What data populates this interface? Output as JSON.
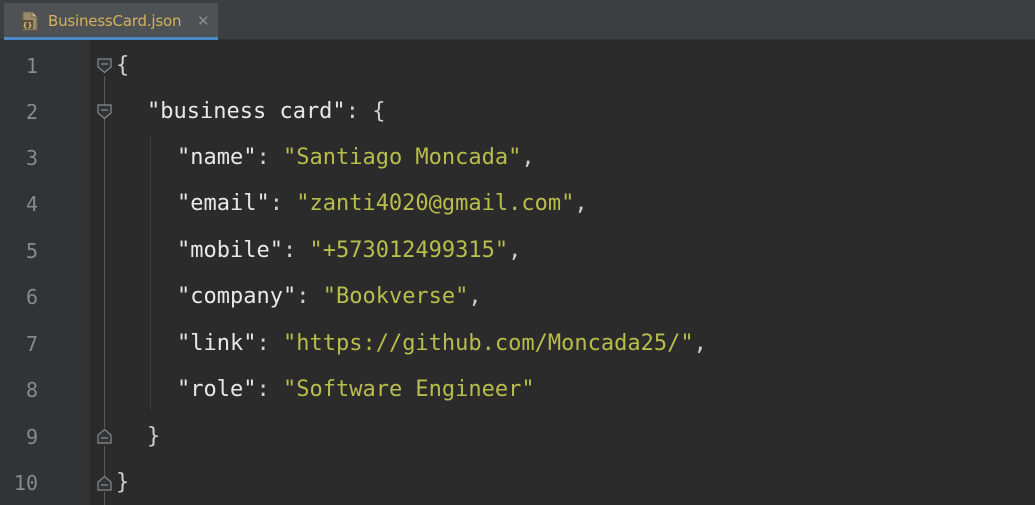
{
  "tab": {
    "file_name": "BusinessCard.json",
    "close_glyph": "✕",
    "icon": "json-file-icon"
  },
  "colors": {
    "background": "#2b2b2b",
    "gutter": "#313335",
    "tab_label": "#d4b25b",
    "string": "#b9bd4b",
    "key": "#e8e8e8",
    "line_number": "#8a8a8a"
  },
  "line_numbers": [
    "1",
    "2",
    "3",
    "4",
    "5",
    "6",
    "7",
    "8",
    "9",
    "10"
  ],
  "code": {
    "line1": {
      "open": "{"
    },
    "line2": {
      "key": "\"business card\"",
      "sep": ": ",
      "open": "{"
    },
    "line3": {
      "key": "\"name\"",
      "sep": ": ",
      "value": "\"Santiago Moncada\"",
      "end": ","
    },
    "line4": {
      "key": "\"email\"",
      "sep": ": ",
      "value": "\"zanti4020@gmail.com\"",
      "end": ","
    },
    "line5": {
      "key": "\"mobile\"",
      "sep": ": ",
      "value": "\"+573012499315\"",
      "end": ","
    },
    "line6": {
      "key": "\"company\"",
      "sep": ": ",
      "value": "\"Bookverse\"",
      "end": ","
    },
    "line7": {
      "key": "\"link\"",
      "sep": ": ",
      "value": "\"https://github.com/Moncada25/\"",
      "end": ","
    },
    "line8": {
      "key": "\"role\"",
      "sep": ": ",
      "value": "\"Software Engineer\"",
      "end": ""
    },
    "line9": {
      "close": "}"
    },
    "line10": {
      "close": "}"
    }
  }
}
